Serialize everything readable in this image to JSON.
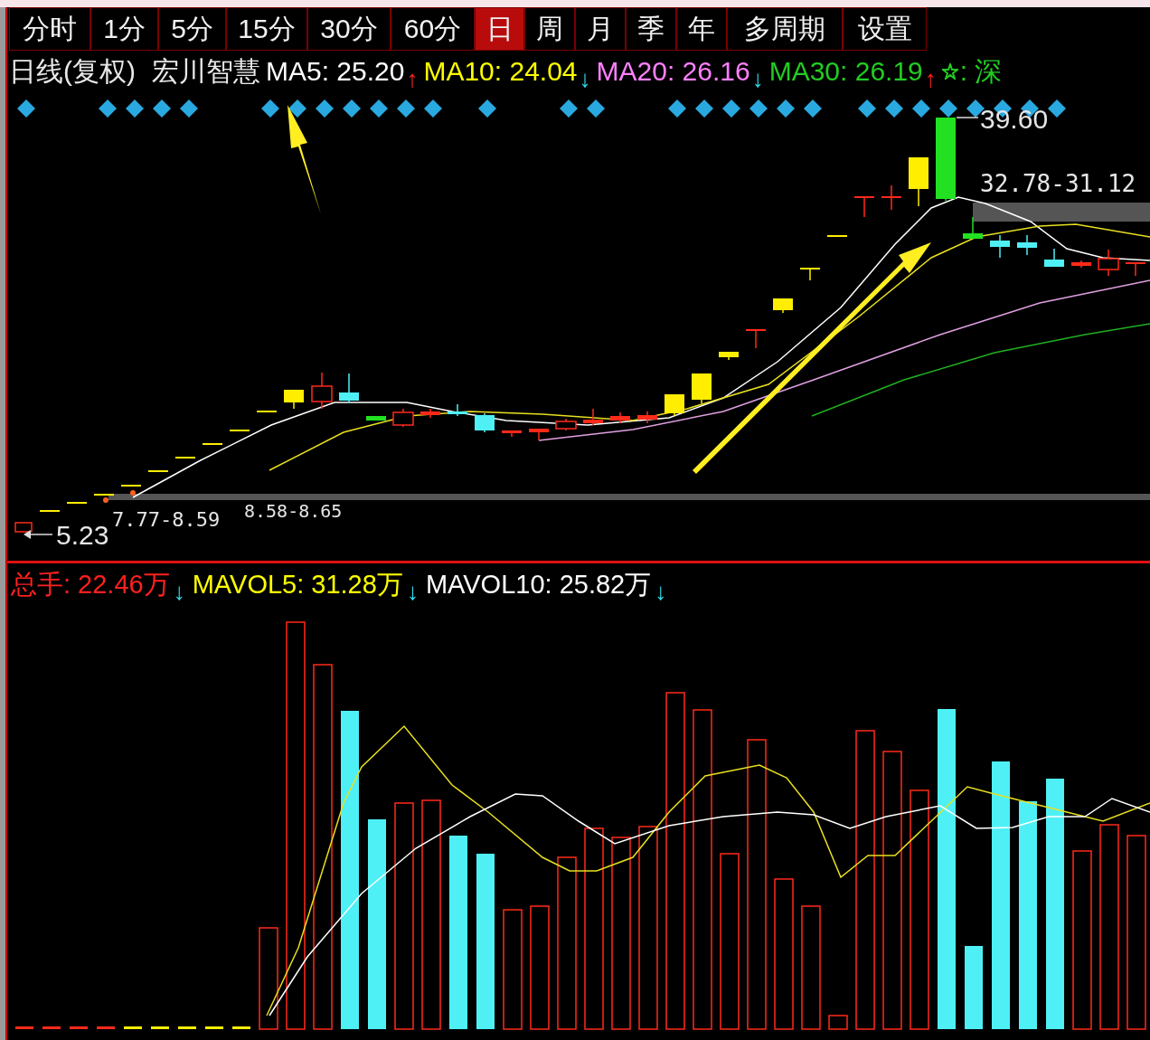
{
  "tabs": [
    {
      "label": "分时",
      "selected": false
    },
    {
      "label": "1分",
      "selected": false
    },
    {
      "label": "5分",
      "selected": false
    },
    {
      "label": "15分",
      "selected": false
    },
    {
      "label": "30分",
      "selected": false
    },
    {
      "label": "60分",
      "selected": false
    },
    {
      "label": "日",
      "selected": true
    },
    {
      "label": "周",
      "selected": false
    },
    {
      "label": "月",
      "selected": false
    },
    {
      "label": "季",
      "selected": false
    },
    {
      "label": "年",
      "selected": false
    },
    {
      "label": "多周期",
      "selected": false
    },
    {
      "label": "设置",
      "selected": false
    }
  ],
  "price_header": {
    "period": "日线(复权)",
    "stock": "宏川智慧",
    "indicators": [
      {
        "label": "MA5:",
        "value": "25.20",
        "arrow": {
          "glyph": "↑",
          "color": "#ff2020"
        },
        "color": "#ffffff"
      },
      {
        "label": "MA10:",
        "value": "24.04",
        "arrow": {
          "glyph": "↓",
          "color": "#33ddee"
        },
        "color": "#ffff00"
      },
      {
        "label": "MA20:",
        "value": "26.16",
        "arrow": {
          "glyph": "↓",
          "color": "#33ddee"
        },
        "color": "#ff80ff"
      },
      {
        "label": "MA30:",
        "value": "26.19",
        "arrow": {
          "glyph": "↑",
          "color": "#ff2020"
        },
        "color": "#22cc22"
      }
    ],
    "extra": ": 深"
  },
  "price_labels": {
    "high": "39.60",
    "gap_upper": "32.78-31.12",
    "low": "5.23",
    "gap_lower_a": "7.77-8.59",
    "gap_lower_b": "8.58-8.65"
  },
  "volume_header": {
    "indicators": [
      {
        "label": "总手:",
        "value": "22.46万",
        "arrow": {
          "glyph": "↓",
          "color": "#33ddee"
        },
        "color": "#ff2020"
      },
      {
        "label": "MAVOL5:",
        "value": "31.28万",
        "arrow": {
          "glyph": "↓",
          "color": "#33ddee"
        },
        "color": "#ffff00"
      },
      {
        "label": "MAVOL10:",
        "value": "25.82万",
        "arrow": {
          "glyph": "↓",
          "color": "#33ddee"
        },
        "color": "#ffffff"
      }
    ]
  }
}
